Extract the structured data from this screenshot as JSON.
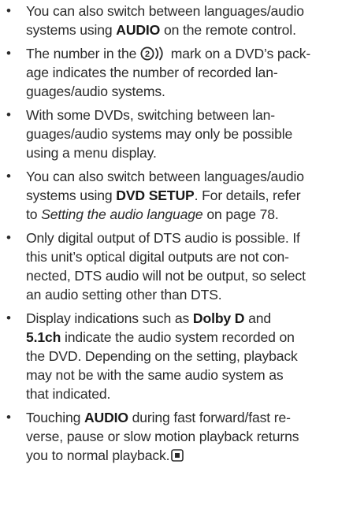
{
  "notes": [
    {
      "lines": [
        [
          "You can also switch between languages/audio"
        ],
        [
          "systems using ",
          "AUDIO",
          " on the remote control."
        ]
      ]
    },
    {
      "lines": [
        [
          "The number in the ",
          "mark on a DVD’s pack-"
        ],
        [
          "age indicates the number of recorded lan-"
        ],
        [
          "guages/audio systems."
        ]
      ],
      "icon": "audio-count-mark-icon",
      "icon_number": "2"
    },
    {
      "lines": [
        [
          "With some DVDs, switching between lan-"
        ],
        [
          "guages/audio systems may only be possible"
        ],
        [
          "using a menu display."
        ]
      ]
    },
    {
      "lines": [
        [
          "You can also switch between languages/audio"
        ],
        [
          "systems using ",
          "DVD SETUP",
          ". For details, refer"
        ],
        [
          "to ",
          "Setting the audio language",
          " on page 78."
        ]
      ]
    },
    {
      "lines": [
        [
          "Only digital output of DTS audio is possible. If"
        ],
        [
          "this unit’s optical digital outputs are not con-"
        ],
        [
          "nected, DTS audio will not be output, so select"
        ],
        [
          "an audio setting other than DTS."
        ]
      ]
    },
    {
      "lines": [
        [
          "Display indications such as ",
          "Dolby D",
          " and"
        ],
        [
          "5.1ch",
          " indicate the audio system recorded on"
        ],
        [
          "the DVD. Depending on the setting, playback"
        ],
        [
          "may not be with the same audio system as"
        ],
        [
          "that indicated."
        ]
      ]
    },
    {
      "lines": [
        [
          "Touching ",
          "AUDIO",
          " during fast forward/fast re-"
        ],
        [
          "verse, pause or slow motion playback returns"
        ],
        [
          "you to normal playback."
        ]
      ],
      "end_icon": "end-of-section-icon"
    }
  ],
  "bullet_char": "•",
  "colors": {
    "text": "#2b2b2b",
    "bold": "#1a1a1a"
  }
}
